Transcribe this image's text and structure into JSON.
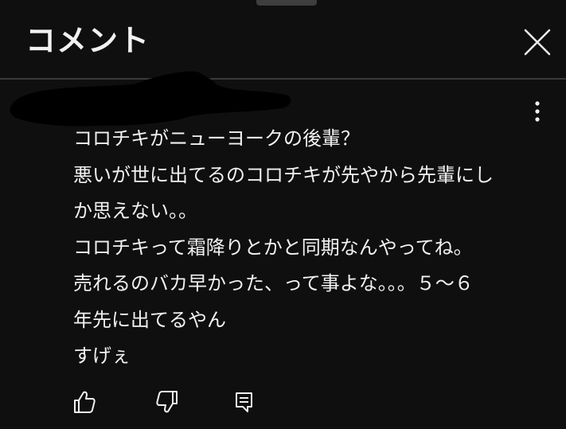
{
  "header": {
    "title": "コメント",
    "close_icon": "close-icon"
  },
  "comment": {
    "author_redacted": true,
    "more_icon": "more-vertical-icon",
    "lines": [
      "コロチキがニューヨークの後輩？",
      "悪いが世に出てるのコロチキが先やから先輩にし",
      "か思えない。。",
      "コロチキって霜降りとかと同期なんやってね。",
      "売れるのバカ早かった、って事よな。。。５〜６",
      "年先に出てるやん",
      "すげぇ"
    ]
  },
  "actions": {
    "like_icon": "thumbs-up-icon",
    "dislike_icon": "thumbs-down-icon",
    "reply_icon": "reply-comment-icon"
  }
}
